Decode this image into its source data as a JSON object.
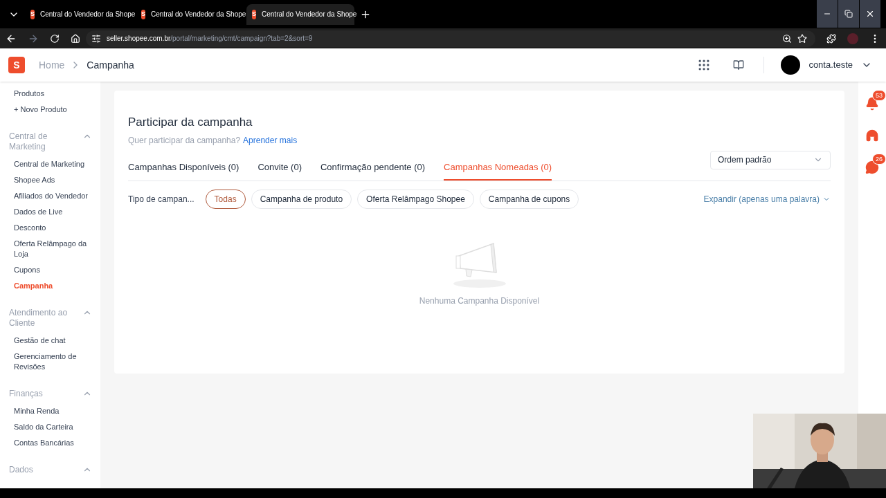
{
  "browser": {
    "tabs": [
      {
        "favicon": "S",
        "title": "Central do Vendedor da Shope",
        "selected": false
      },
      {
        "favicon": "S",
        "title": "Central do Vendedor da Shope",
        "selected": false
      },
      {
        "favicon": "S",
        "title": "Central do Vendedor da Shope",
        "selected": true
      }
    ],
    "url_host": "seller.shopee.com.br",
    "url_path": "/portal/marketing/cmt/campaign?tab=2&sort=9"
  },
  "header": {
    "logo": "S",
    "breadcrumb": [
      "Home",
      "Campanha"
    ],
    "account": "conta.teste"
  },
  "sidebar": {
    "sections": [
      {
        "items": [
          {
            "label": "Produtos",
            "selected": false
          },
          {
            "label": "+ Novo Produto",
            "selected": false
          }
        ]
      },
      {
        "title": "Central de Marketing",
        "expanded": true,
        "items": [
          {
            "label": "Central de Marketing",
            "selected": false
          },
          {
            "label": "Shopee Ads",
            "selected": false
          },
          {
            "label": "Afiliados do Vendedor",
            "selected": false
          },
          {
            "label": "Dados de Live",
            "selected": false
          },
          {
            "label": "Desconto",
            "selected": false
          },
          {
            "label": "Oferta Relâmpago da Loja",
            "selected": false
          },
          {
            "label": "Cupons",
            "selected": false
          },
          {
            "label": "Campanha",
            "selected": true
          }
        ]
      },
      {
        "title": "Atendimento ao Cliente",
        "expanded": true,
        "items": [
          {
            "label": "Gestão de chat",
            "selected": false
          },
          {
            "label": "Gerenciamento de Revisões",
            "selected": false
          }
        ]
      },
      {
        "title": "Finanças",
        "expanded": true,
        "items": [
          {
            "label": "Minha Renda",
            "selected": false
          },
          {
            "label": "Saldo da Carteira",
            "selected": false
          },
          {
            "label": "Contas Bancárias",
            "selected": false
          }
        ]
      },
      {
        "title": "Dados",
        "expanded": true
      }
    ]
  },
  "card": {
    "title": "Participar da campanha",
    "subtitle": "Quer participar da campanha?",
    "learn_more": "Aprender mais",
    "tabs": [
      {
        "label": "Campanhas Disponíveis (0)",
        "selected": false
      },
      {
        "label": "Convite (0)",
        "selected": false
      },
      {
        "label": "Confirmação pendente (0)",
        "selected": false
      },
      {
        "label": "Campanhas Nomeadas (0)",
        "selected": true
      }
    ],
    "sort": "Ordem padrão",
    "filter_label": "Tipo de campan...",
    "filters": [
      {
        "label": "Todas",
        "selected": true
      },
      {
        "label": "Campanha de produto",
        "selected": false
      },
      {
        "label": "Oferta Relâmpago Shopee",
        "selected": false
      },
      {
        "label": "Campanha de cupons",
        "selected": false
      }
    ],
    "expand": "Expandir (apenas uma palavra)",
    "empty": "Nenhuma Campanha Disponível"
  },
  "right_rail": [
    {
      "kind": "bell",
      "badge": "53"
    },
    {
      "kind": "support"
    },
    {
      "kind": "chat",
      "badge": "26"
    }
  ]
}
